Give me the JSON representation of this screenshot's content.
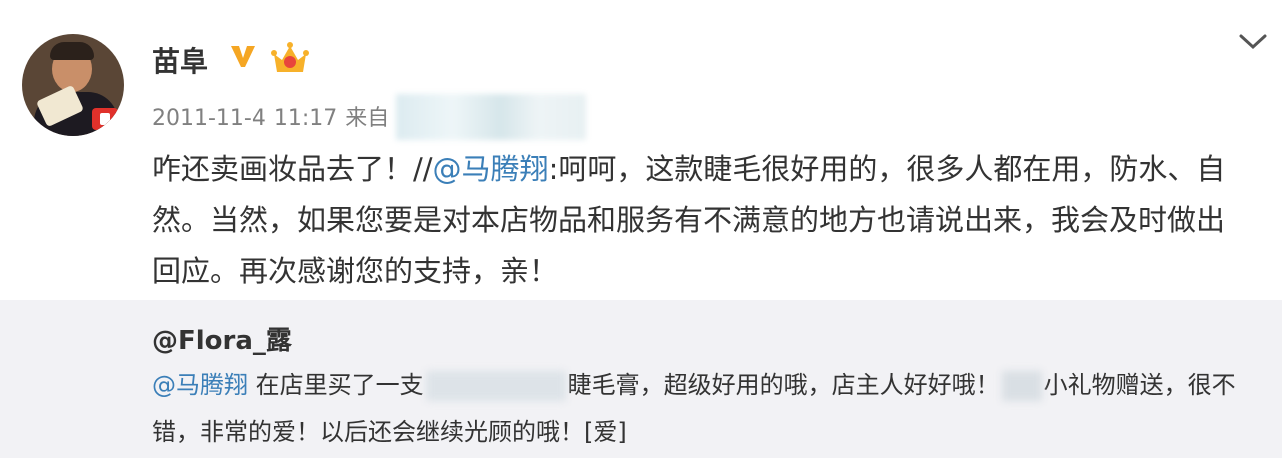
{
  "post": {
    "author_name": "苗阜",
    "verified_icon": "vip-v-icon",
    "member_icon": "crown-icon",
    "menu_icon": "chevron-down-icon",
    "date": "2011-11-4",
    "time": "11:17",
    "source_prefix": "来自",
    "content": {
      "part1": "咋还卖画妆品去了！//",
      "mention": "@马腾翔",
      "part2": ":呵呵，这款睫毛很好用的，很多人都在用，防水、自然。当然，如果您要是对本店物品和服务有不满意的地方也请说出来，我会及时做出回应。再次感谢您的支持，亲！"
    }
  },
  "repost": {
    "user": "@Flora_露",
    "mention": "@马腾翔",
    "text_a": " 在店里买了一支",
    "text_b": "睫毛膏，超级好用的哦，店主人好好哦！",
    "text_c": "小礼物赠送，很不错，非常的爱！以后还会继续光顾的哦！[爱]"
  },
  "colors": {
    "mention": "#3b7fb8",
    "meta": "#808080",
    "repost_bg": "#f2f2f5",
    "vip": "#f5a623"
  }
}
